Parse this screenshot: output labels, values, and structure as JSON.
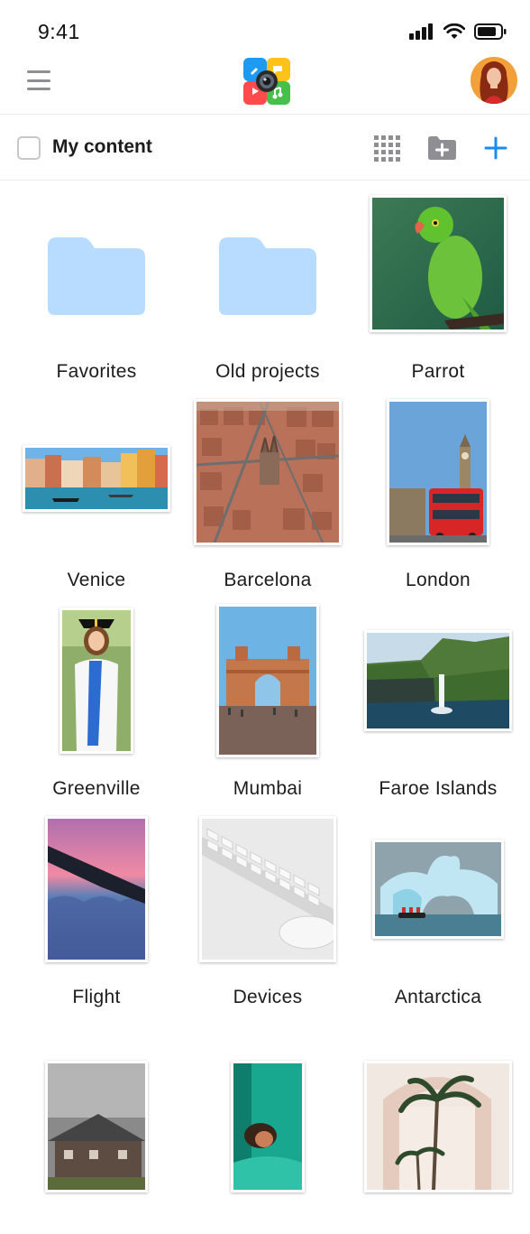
{
  "status": {
    "time": "9:41"
  },
  "header": {
    "logo": "camera-collage-app-icon",
    "menu_icon": "hamburger-menu-icon",
    "avatar_icon": "user-avatar"
  },
  "toolbar": {
    "title": "My content",
    "grid_icon": "grid-view-icon",
    "new_folder_icon": "new-folder-icon",
    "add_icon": "plus-icon",
    "accent": "#1a8cf0"
  },
  "items": [
    {
      "label": "Favorites",
      "kind": "folder"
    },
    {
      "label": "Old projects",
      "kind": "folder"
    },
    {
      "label": "Parrot",
      "kind": "photo"
    },
    {
      "label": "Venice",
      "kind": "photo"
    },
    {
      "label": "Barcelona",
      "kind": "photo"
    },
    {
      "label": "London",
      "kind": "photo"
    },
    {
      "label": "Greenville",
      "kind": "photo"
    },
    {
      "label": "Mumbai",
      "kind": "photo"
    },
    {
      "label": "Faroe Islands",
      "kind": "photo"
    },
    {
      "label": "Flight",
      "kind": "photo"
    },
    {
      "label": "Devices",
      "kind": "photo"
    },
    {
      "label": "Antarctica",
      "kind": "photo"
    },
    {
      "label": "",
      "kind": "photo"
    },
    {
      "label": "",
      "kind": "photo"
    },
    {
      "label": "",
      "kind": "photo"
    }
  ],
  "colors": {
    "folder": "#b8dcff",
    "divider": "#ececec"
  }
}
